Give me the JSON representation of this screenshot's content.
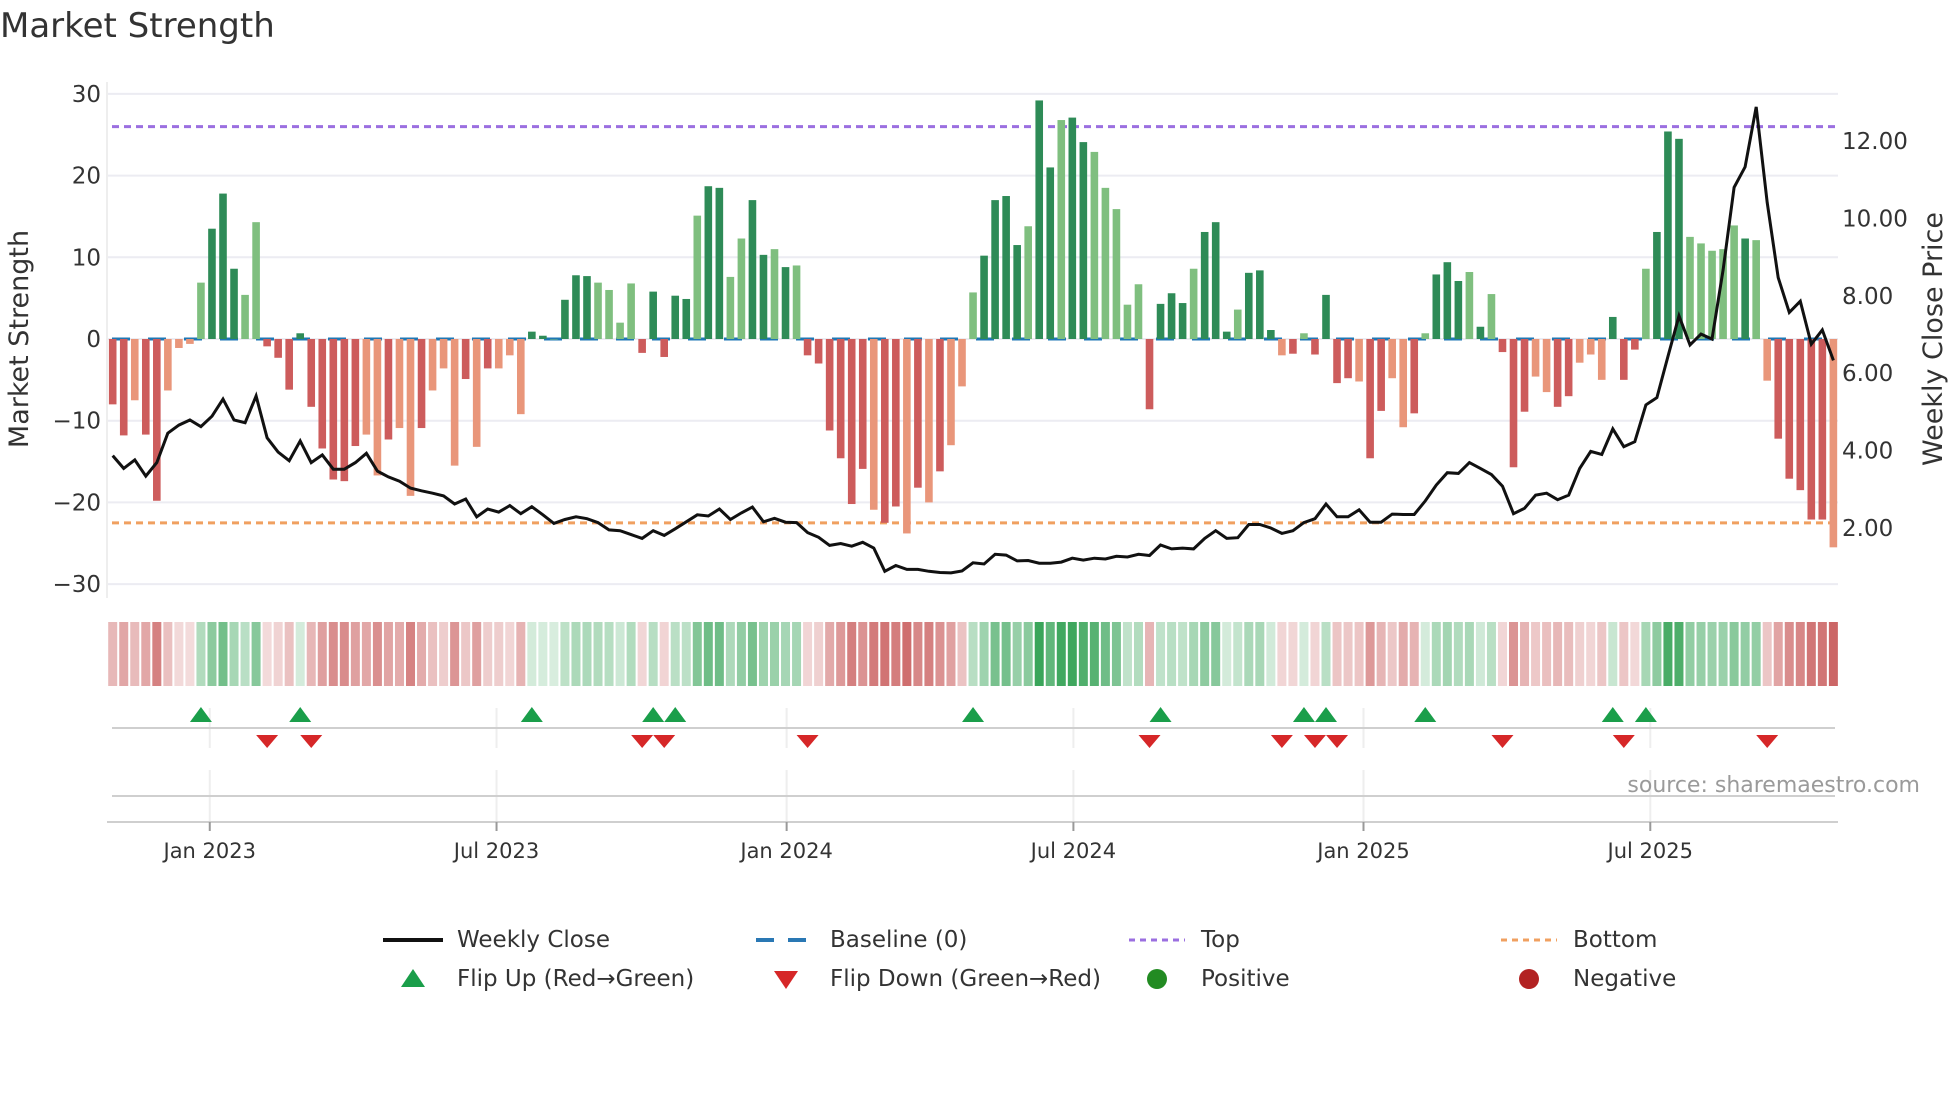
{
  "chart_data": {
    "type": "bar",
    "title": "Market Strength",
    "ylabel": "Market Strength",
    "y2label": "Weekly Close Price",
    "ylim": [
      -32,
      32
    ],
    "yticks": [
      30,
      20,
      10,
      0,
      -10,
      -20,
      -30
    ],
    "yticklabels": [
      "30",
      "20",
      "10",
      "0",
      "−10",
      "−20",
      "−30"
    ],
    "y2lim": [
      0,
      13.5
    ],
    "y2ticks": [
      12,
      10,
      8,
      6,
      4,
      2
    ],
    "y2ticklabels": [
      "12.00",
      "10.00",
      "8.00",
      "6.00",
      "4.00",
      "2.00"
    ],
    "top_level": 26,
    "bottom_level": -22.5,
    "baseline": 0,
    "x_unit": "week index",
    "xticks": [
      {
        "label": "Jan 2023",
        "week": 9.8
      },
      {
        "label": "Jul 2023",
        "week": 35.8
      },
      {
        "label": "Jan 2024",
        "week": 62.1
      },
      {
        "label": "Jul 2024",
        "week": 88.1
      },
      {
        "label": "Jan 2025",
        "week": 114.4
      },
      {
        "label": "Jul 2025",
        "week": 140.4
      }
    ],
    "strength": [
      -8.0,
      -11.8,
      -7.5,
      -11.7,
      -19.8,
      -6.3,
      -1.1,
      -0.6,
      6.9,
      13.5,
      17.8,
      8.6,
      5.4,
      14.3,
      -0.9,
      -2.3,
      -6.2,
      0.7,
      -8.3,
      -13.4,
      -17.2,
      -17.4,
      -13.1,
      -11.7,
      -16.7,
      -12.3,
      -10.9,
      -19.2,
      -10.9,
      -6.3,
      -3.6,
      -15.5,
      -4.9,
      -13.2,
      -3.6,
      -3.6,
      -2.0,
      -9.2,
      0.9,
      0.4,
      0,
      4.8,
      7.8,
      7.7,
      6.9,
      6.0,
      2.0,
      6.8,
      -1.7,
      5.8,
      -2.2,
      5.3,
      4.9,
      15.1,
      18.7,
      18.5,
      7.6,
      12.3,
      17.0,
      10.3,
      11.0,
      8.8,
      9.0,
      -2.0,
      -3.0,
      -11.2,
      -14.6,
      -20.2,
      -15.9,
      -20.9,
      -22.5,
      -20.5,
      -23.8,
      -18.2,
      -20.0,
      -16.2,
      -13.0,
      -5.8,
      5.7,
      10.2,
      17.0,
      17.5,
      11.5,
      13.8,
      29.2,
      21.0,
      26.8,
      27.1,
      24.1,
      22.9,
      18.5,
      15.9,
      4.2,
      6.7,
      -8.6,
      4.3,
      5.6,
      4.4,
      8.6,
      13.1,
      14.3,
      0.9,
      3.6,
      8.1,
      8.4,
      1.1,
      -2.0,
      -1.8,
      0.7,
      -1.9,
      5.4,
      -5.4,
      -4.8,
      -5.2,
      -14.6,
      -8.8,
      -4.8,
      -10.8,
      -9.1,
      0.7,
      7.9,
      9.4,
      7.1,
      8.2,
      1.5,
      5.5,
      -1.6,
      -15.7,
      -8.9,
      -4.6,
      -6.5,
      -8.3,
      -7.0,
      -2.9,
      -1.9,
      -5.0,
      2.7,
      -5.0,
      -1.3,
      8.6,
      13.1,
      25.4,
      24.5,
      12.5,
      11.7,
      10.8,
      11.0,
      13.9,
      12.3,
      12.1,
      -5.1,
      -12.2,
      -17.1,
      -18.5,
      -22.1,
      -22.1,
      -25.5
    ],
    "shade": [
      "ddlddlllldd",
      "dllddddddd",
      "ddlldlldll",
      "ldldlllddl",
      "dddllllddd",
      "ddlddllddl",
      "dlddddddld",
      "dldldllldd",
      "ddlddlddll",
      "lllddddldd",
      "dldddldldd",
      "ddlddlldld",
      "ddldldddll",
      "ddllldddld",
      "ddllllldll",
      "dddddld"
    ],
    "weekly_close": [
      3.87,
      3.54,
      3.76,
      3.34,
      3.69,
      4.45,
      4.66,
      4.79,
      4.62,
      4.89,
      5.33,
      4.79,
      4.72,
      5.41,
      4.33,
      3.96,
      3.74,
      4.25,
      3.69,
      3.89,
      3.52,
      3.52,
      3.69,
      3.93,
      3.47,
      3.32,
      3.21,
      3.03,
      2.96,
      2.9,
      2.83,
      2.62,
      2.75,
      2.29,
      2.49,
      2.41,
      2.58,
      2.37,
      2.55,
      2.34,
      2.12,
      2.22,
      2.29,
      2.24,
      2.14,
      1.95,
      1.93,
      1.83,
      1.73,
      1.93,
      1.81,
      1.98,
      2.16,
      2.34,
      2.31,
      2.49,
      2.22,
      2.39,
      2.54,
      2.16,
      2.25,
      2.15,
      2.14,
      1.88,
      1.76,
      1.55,
      1.6,
      1.53,
      1.63,
      1.48,
      0.88,
      1.03,
      0.93,
      0.93,
      0.88,
      0.85,
      0.84,
      0.89,
      1.1,
      1.07,
      1.32,
      1.3,
      1.15,
      1.16,
      1.09,
      1.09,
      1.12,
      1.22,
      1.17,
      1.22,
      1.2,
      1.27,
      1.25,
      1.32,
      1.29,
      1.56,
      1.46,
      1.48,
      1.46,
      1.73,
      1.93,
      1.73,
      1.75,
      2.09,
      2.09,
      2.0,
      1.86,
      1.93,
      2.14,
      2.24,
      2.62,
      2.29,
      2.29,
      2.47,
      2.15,
      2.15,
      2.36,
      2.35,
      2.35,
      2.7,
      3.11,
      3.43,
      3.41,
      3.69,
      3.54,
      3.38,
      3.08,
      2.37,
      2.51,
      2.85,
      2.9,
      2.73,
      2.85,
      3.54,
      3.98,
      3.9,
      4.56,
      4.1,
      4.23,
      5.18,
      5.37,
      6.43,
      7.48,
      6.73,
      7.01,
      6.88,
      8.67,
      10.8,
      11.33,
      12.88,
      10.41,
      8.47,
      7.57,
      7.86,
      6.75,
      7.12,
      6.33
    ],
    "flip_up_weeks": [
      9,
      18,
      39,
      50,
      52,
      79,
      96,
      109,
      111,
      120,
      137,
      140
    ],
    "flip_down_weeks": [
      15,
      19,
      49,
      51,
      64,
      95,
      107,
      110,
      112,
      127,
      138,
      151
    ],
    "legend": {
      "weekly_close": "Weekly Close",
      "baseline": "Baseline (0)",
      "top": "Top",
      "bottom": "Bottom",
      "flip_up": "Flip Up (Red→Green)",
      "flip_down": "Flip Down (Green→Red)",
      "positive": "Positive",
      "negative": "Negative"
    },
    "legend_placement": "bottom",
    "source": "source: sharemaestro.com",
    "colors": {
      "pos_dark": "#2e8b57",
      "pos_light": "#7fbf7f",
      "neg_dark": "#cd5c5c",
      "neg_light": "#e9967a",
      "baseline": "#1f77b4",
      "top": "#9b6fe0",
      "bottom": "#f0a060",
      "close": "#111111",
      "flip_up": "#1a9e4a",
      "flip_down": "#d62728",
      "positive": "#228b22",
      "negative": "#b22222"
    }
  }
}
